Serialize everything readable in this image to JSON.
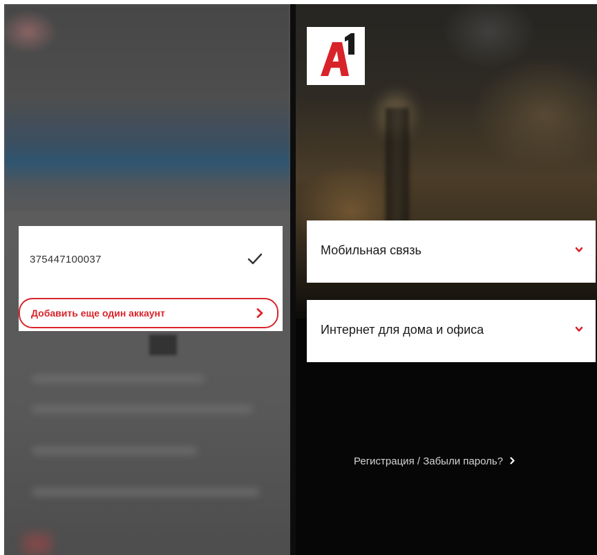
{
  "left_screen": {
    "account_dialog": {
      "account_number": "375447100037",
      "check_icon": "check-icon",
      "add_account_label": "Добавить еще один аккаунт",
      "add_account_icon": "chevron-right-icon"
    }
  },
  "right_screen": {
    "logo": {
      "text": "A1"
    },
    "sections": [
      {
        "label": "Мобильная связь",
        "icon": "chevron-down-icon"
      },
      {
        "label": "Интернет для дома и офиса",
        "icon": "chevron-down-icon"
      }
    ],
    "register_link": "Регистрация / Забыли пароль?"
  },
  "colors": {
    "brand_red": "#d8232a",
    "dark_background": "#060606",
    "link_text": "#d4d4d4"
  }
}
